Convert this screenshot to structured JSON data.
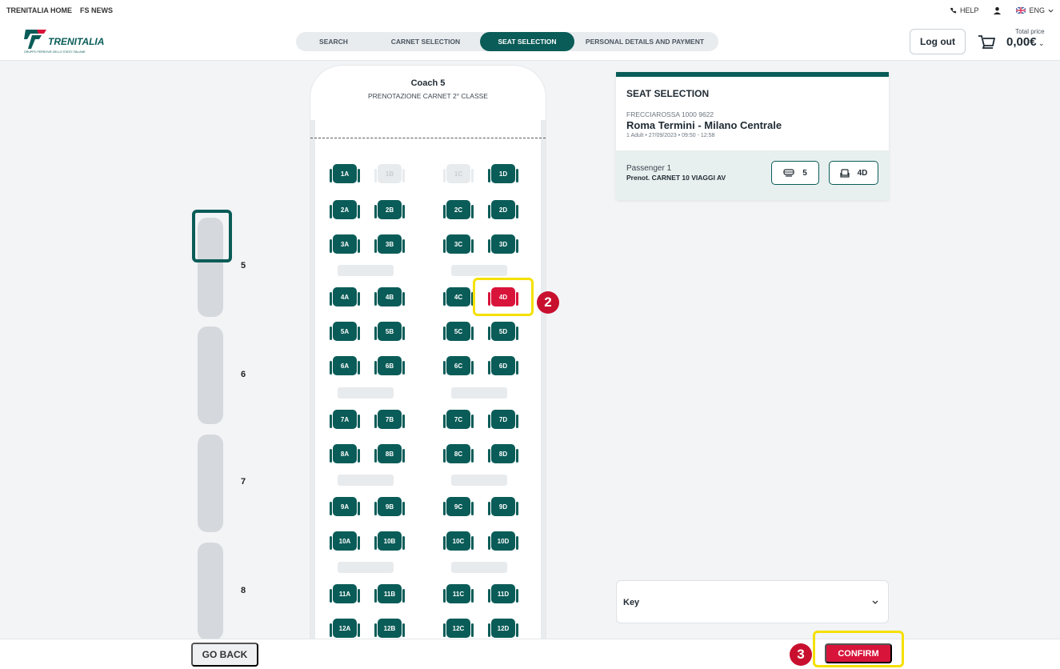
{
  "utility": {
    "links": [
      "TRENITALIA HOME",
      "FS NEWS"
    ],
    "help": "HELP",
    "language": "ENG"
  },
  "header": {
    "logo_text": "TRENITALIA",
    "logo_sub": "GRUPPO FERROVIE DELLO STATO ITALIANE",
    "steps": [
      "SEARCH",
      "CARNET SELECTION",
      "SEAT SELECTION",
      "PERSONAL DETAILS AND PAYMENT"
    ],
    "active_step": "SEAT SELECTION",
    "logout": "Log out",
    "price_label": "Total price",
    "price_value": "0,00€"
  },
  "coaches": [
    "5",
    "6",
    "7",
    "8"
  ],
  "seatmap": {
    "coach_title": "Coach 5",
    "coach_subtitle": "PRENOTAZIONE CARNET 2° CLASSE",
    "rows": [
      [
        "1A",
        "1B",
        "1C",
        "1D"
      ],
      [
        "2A",
        "2B",
        "2C",
        "2D"
      ],
      [
        "3A",
        "3B",
        "3C",
        "3D"
      ],
      [
        "4A",
        "4B",
        "4C",
        "4D"
      ],
      [
        "5A",
        "5B",
        "5C",
        "5D"
      ],
      [
        "6A",
        "6B",
        "6C",
        "6D"
      ],
      [
        "7A",
        "7B",
        "7C",
        "7D"
      ],
      [
        "8A",
        "8B",
        "8C",
        "8D"
      ],
      [
        "9A",
        "9B",
        "9C",
        "9D"
      ],
      [
        "10A",
        "10B",
        "10C",
        "10D"
      ],
      [
        "11A",
        "11B",
        "11C",
        "11D"
      ],
      [
        "12A",
        "12B",
        "12C",
        "12D"
      ]
    ],
    "unavailable": [
      "1B",
      "1C"
    ],
    "selected": "4D"
  },
  "annotations": {
    "step2": "2",
    "step3": "3"
  },
  "summary": {
    "title": "SEAT SELECTION",
    "train": "FRECCIAROSSA 1000 9622",
    "route": "Roma Termini - Milano Centrale",
    "meta": "1 Adult • 27/09/2023 • 09:50 - 12:58",
    "passenger": "Passenger 1",
    "tariff": "Prenot. CARNET 10 VIAGGI AV",
    "coach": "5",
    "seat": "4D"
  },
  "key": {
    "label": "Key"
  },
  "footer": {
    "go_back": "GO BACK",
    "confirm": "CONFIRM"
  },
  "colors": {
    "brand_green": "#0a5c58",
    "selected_red": "#d8143a",
    "highlight_yellow": "#f5e000"
  }
}
